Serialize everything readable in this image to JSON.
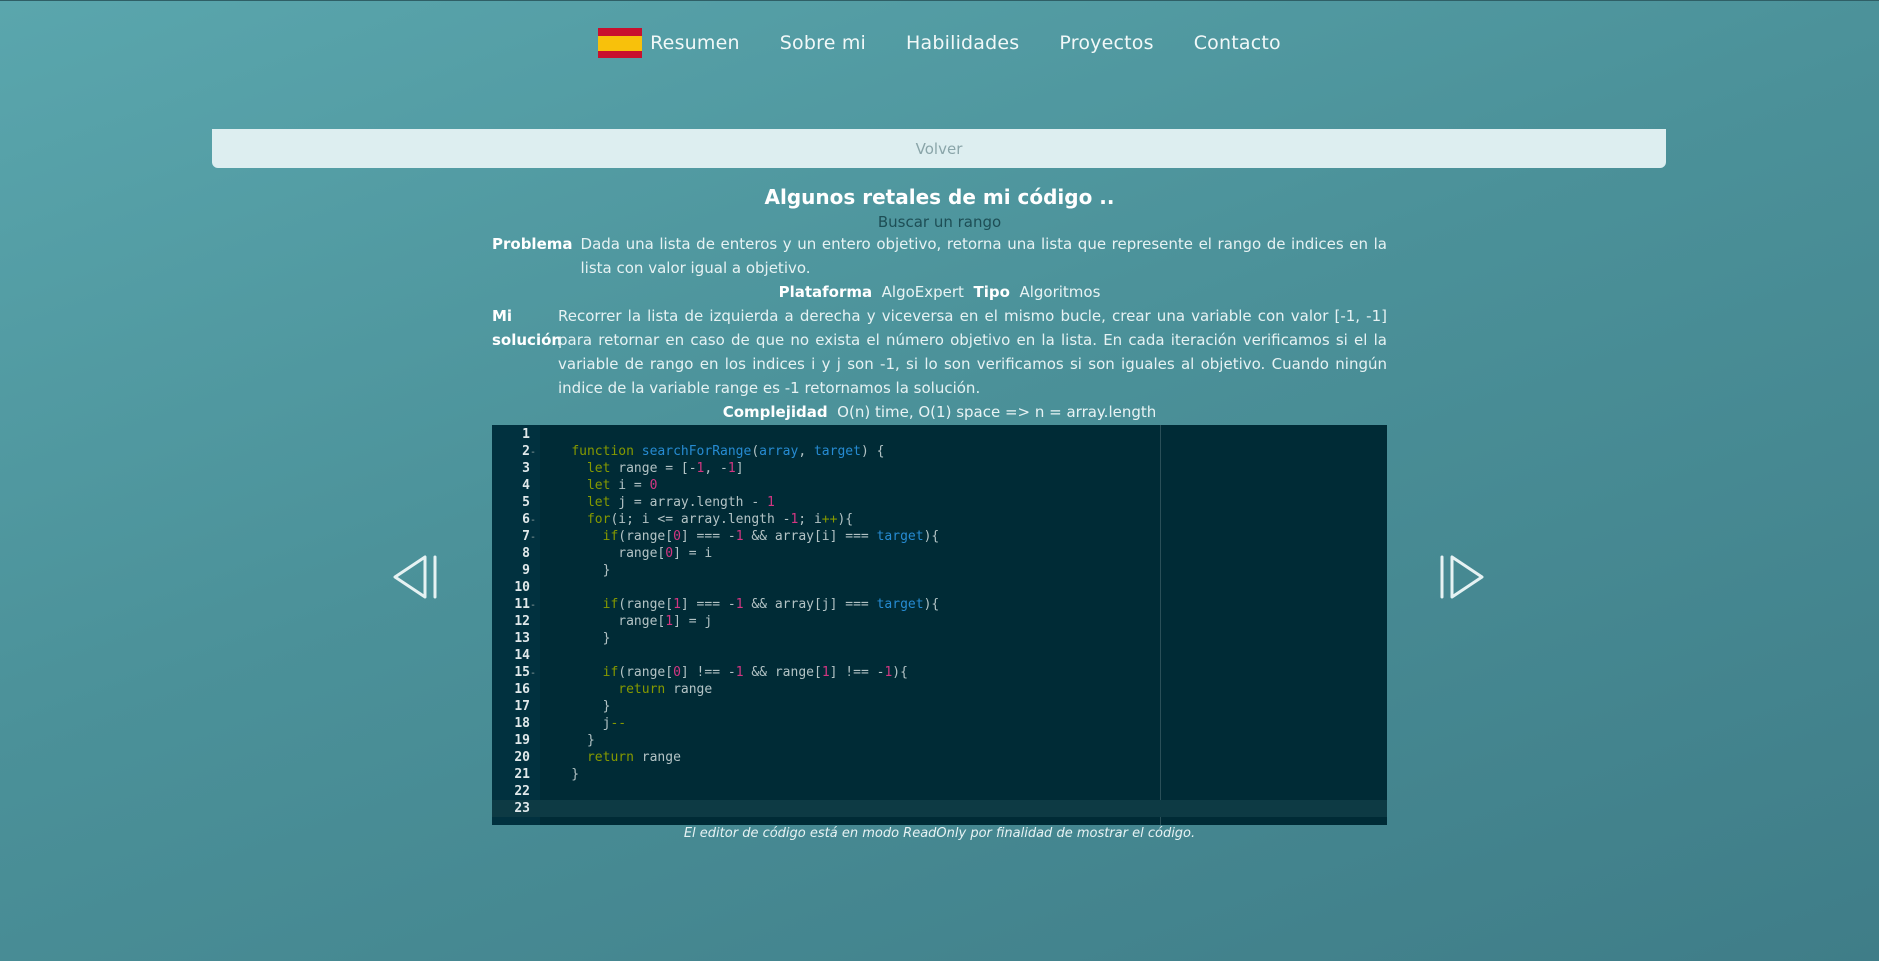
{
  "nav": {
    "items": [
      {
        "label": "Resumen"
      },
      {
        "label": "Sobre mi"
      },
      {
        "label": "Habilidades"
      },
      {
        "label": "Proyectos"
      },
      {
        "label": "Contacto"
      }
    ],
    "flag_icon": "spain-flag-icon"
  },
  "back": {
    "label": "Volver"
  },
  "section": {
    "title": "Algunos retales de mi código ..",
    "subtitle": "Buscar un rango",
    "problem_label": "Problema",
    "problem_text": "Dada una lista de enteros y un entero objetivo, retorna una lista que represente el rango de indices en la lista con valor igual a objetivo.",
    "platform_label": "Plataforma",
    "platform_value": "AlgoExpert",
    "type_label": "Tipo",
    "type_value": "Algoritmos",
    "solution_label": "Mi solución",
    "solution_text": "Recorrer la lista de izquierda a derecha y viceversa en el mismo bucle, crear una variable con valor [-1, -1] para retornar en caso de que no exista el número objetivo en la lista. En cada iteración verificamos si el la variable de rango en los indices i y j son -1, si lo son verificamos si son iguales al objetivo. Cuando ningún indice de la variable range es -1 retornamos la solución.",
    "complexity_label": "Complejidad",
    "complexity_value": "O(n) time, O(1) space => n = array.length"
  },
  "editor": {
    "line_numbers": [
      "1",
      "2",
      "3",
      "4",
      "5",
      "6",
      "7",
      "8",
      "9",
      "10",
      "11",
      "12",
      "13",
      "14",
      "15",
      "16",
      "17",
      "18",
      "19",
      "20",
      "21",
      "22",
      "23"
    ],
    "lines": [
      "",
      "    function searchForRange(array, target) {",
      "      let range = [-1, -1]",
      "      let i = 0",
      "      let j = array.length - 1",
      "      for(i; i <= array.length -1; i++){",
      "        if(range[0] === -1 && array[i] === target){",
      "          range[0] = i",
      "        }",
      "",
      "        if(range[1] === -1 && array[j] === target){",
      "          range[1] = j",
      "        }",
      "",
      "        if(range[0] !== -1 && range[1] !== -1){",
      "          return range",
      "        }",
      "        j--",
      "      }",
      "      return range",
      "    }",
      "",
      ""
    ],
    "note": "El editor de código está en modo ReadOnly por finalidad de mostrar el código."
  },
  "arrows": {
    "prev_icon": "previous-icon",
    "next_icon": "next-icon"
  },
  "colors": {
    "background": "#4b9199",
    "editor_bg": "#002b36",
    "back_bar": "#ddeef0"
  }
}
